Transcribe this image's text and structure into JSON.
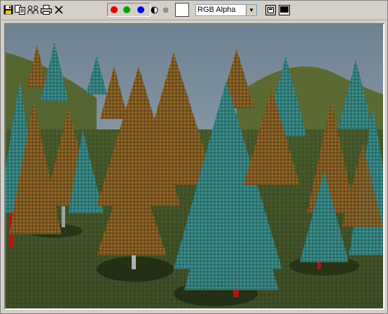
{
  "toolbar": {
    "buttons": [
      {
        "name": "save-icon"
      },
      {
        "name": "copy-icon"
      },
      {
        "name": "clone-window-icon"
      },
      {
        "name": "print-icon"
      },
      {
        "name": "clear-icon"
      }
    ],
    "channels": {
      "red": "#e00000",
      "green": "#00a000",
      "blue": "#0000e0",
      "monochrome_icon": "half-circle-icon",
      "alpha_icon": "gray-dot-icon"
    },
    "background_swatch": "#ffffff",
    "channel_select": {
      "value": "RGB Alpha"
    },
    "right_buttons": [
      {
        "name": "toggle-ui-icon"
      },
      {
        "name": "display-icon"
      }
    ]
  },
  "viewport": {
    "content": "rendered-forest-image",
    "sky_color": "#7b8e9e",
    "ground_color": "#4a5a2a"
  }
}
